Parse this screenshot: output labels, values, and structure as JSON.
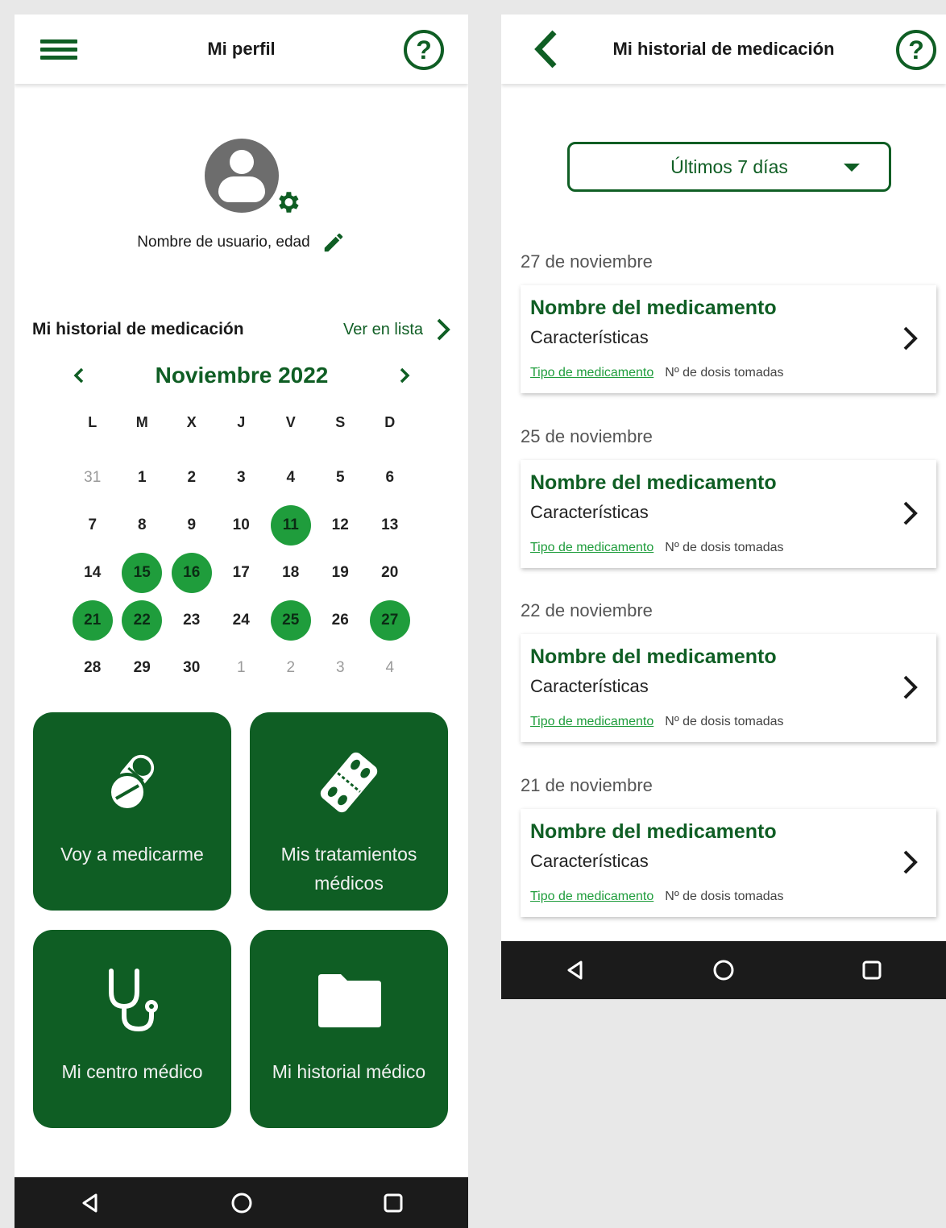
{
  "colors": {
    "primary": "#0f5e24",
    "highlight": "#1f9d3c",
    "navbar": "#1b1b1b"
  },
  "profile": {
    "title": "Mi perfil",
    "menu_icon": "hamburger-menu-icon",
    "help_icon": "question-circle-icon",
    "help_glyph": "?",
    "username": "Nombre de usuario, edad",
    "history_title": "Mi historial de medicación",
    "list_link": "Ver en lista",
    "calendar": {
      "month": "Noviembre 2022",
      "weekdays": [
        "L",
        "M",
        "X",
        "J",
        "V",
        "S",
        "D"
      ],
      "days": [
        {
          "d": "31",
          "muted": true
        },
        {
          "d": "1"
        },
        {
          "d": "2"
        },
        {
          "d": "3"
        },
        {
          "d": "4"
        },
        {
          "d": "5"
        },
        {
          "d": "6"
        },
        {
          "d": "7"
        },
        {
          "d": "8"
        },
        {
          "d": "9"
        },
        {
          "d": "10"
        },
        {
          "d": "11",
          "sel": true
        },
        {
          "d": "12"
        },
        {
          "d": "13"
        },
        {
          "d": "14"
        },
        {
          "d": "15",
          "sel": true
        },
        {
          "d": "16",
          "sel": true
        },
        {
          "d": "17"
        },
        {
          "d": "18"
        },
        {
          "d": "19"
        },
        {
          "d": "20"
        },
        {
          "d": "21",
          "sel": true
        },
        {
          "d": "22",
          "sel": true
        },
        {
          "d": "23"
        },
        {
          "d": "24"
        },
        {
          "d": "25",
          "sel": true
        },
        {
          "d": "26"
        },
        {
          "d": "27",
          "sel": true
        },
        {
          "d": "28"
        },
        {
          "d": "29"
        },
        {
          "d": "30"
        },
        {
          "d": "1",
          "muted": true
        },
        {
          "d": "2",
          "muted": true
        },
        {
          "d": "3",
          "muted": true
        },
        {
          "d": "4",
          "muted": true
        }
      ]
    },
    "tiles": {
      "medicate": "Voy a medicarme",
      "treatments": "Mis tratamientos médicos",
      "center": "Mi centro médico",
      "history": "Mi historial médico"
    }
  },
  "history": {
    "title": "Mi historial de medicación",
    "help_glyph": "?",
    "filter": "Últimos 7 días",
    "entries": [
      {
        "date": "27 de noviembre",
        "name": "Nombre del medicamento",
        "characteristics": "Características",
        "type": "Tipo de medicamento",
        "doses": "Nº de dosis tomadas"
      },
      {
        "date": "25 de noviembre",
        "name": "Nombre del medicamento",
        "characteristics": "Características",
        "type": "Tipo de medicamento",
        "doses": "Nº de dosis tomadas"
      },
      {
        "date": "22 de noviembre",
        "name": "Nombre del medicamento",
        "characteristics": "Características",
        "type": "Tipo de medicamento",
        "doses": "Nº de dosis tomadas"
      },
      {
        "date": "21 de noviembre",
        "name": "Nombre del medicamento",
        "characteristics": "Características",
        "type": "Tipo de medicamento",
        "doses": "Nº de dosis tomadas"
      }
    ]
  }
}
